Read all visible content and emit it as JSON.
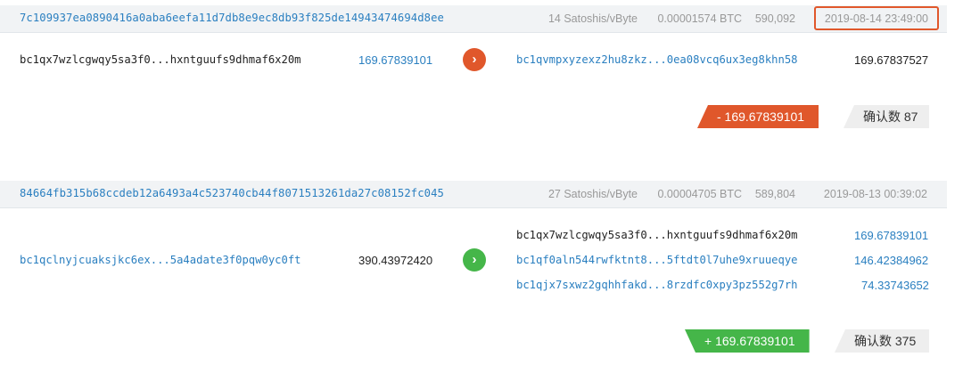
{
  "transactions": [
    {
      "hash": "7c109937ea0890416a0aba6eefa11d7db8e9ec8db93f825de14943474694d8ee",
      "fee_rate": "14 Satoshis/vByte",
      "fee": "0.00001574 BTC",
      "block": "590,092",
      "time": "2019-08-14 23:49:00",
      "inputs": [
        {
          "address": "bc1qx7wzlcgwqy5sa3f0...hxntguufs9dhmaf6x20m",
          "value": "169.67839101"
        }
      ],
      "outputs": [
        {
          "address": "bc1qvmpxyzexz2hu8zkz...0ea08vcq6ux3eg8khn58",
          "value": "169.67837527"
        }
      ],
      "balance_change": "- 169.67839101",
      "confirmations": "确认数 87",
      "direction": "out",
      "accent": "#e0572b"
    },
    {
      "hash": "84664fb315b68ccdeb12a6493a4c523740cb44f8071513261da27c08152fc045",
      "fee_rate": "27 Satoshis/vByte",
      "fee": "0.00004705 BTC",
      "block": "589,804",
      "time": "2019-08-13 00:39:02",
      "inputs": [
        {
          "address": "bc1qclnyjcuaksjkc6ex...5a4adate3f0pqw0yc0ft",
          "value": "390.43972420"
        }
      ],
      "outputs": [
        {
          "address": "bc1qx7wzlcgwqy5sa3f0...hxntguufs9dhmaf6x20m",
          "value": "169.67839101"
        },
        {
          "address": "bc1qf0aln544rwfktnt8...5ftdt0l7uhe9xruueqye",
          "value": "146.42384962"
        },
        {
          "address": "bc1qjx7sxwz2gqhhfakd...8rzdfc0xpy3pz552g7rh",
          "value": "74.33743652"
        }
      ],
      "balance_change": "+ 169.67839101",
      "confirmations": "确认数 375",
      "direction": "in",
      "accent": "#45b649"
    }
  ],
  "icons": {
    "out_arrow": "chevron-right-icon",
    "in_arrow": "chevron-right-icon"
  }
}
